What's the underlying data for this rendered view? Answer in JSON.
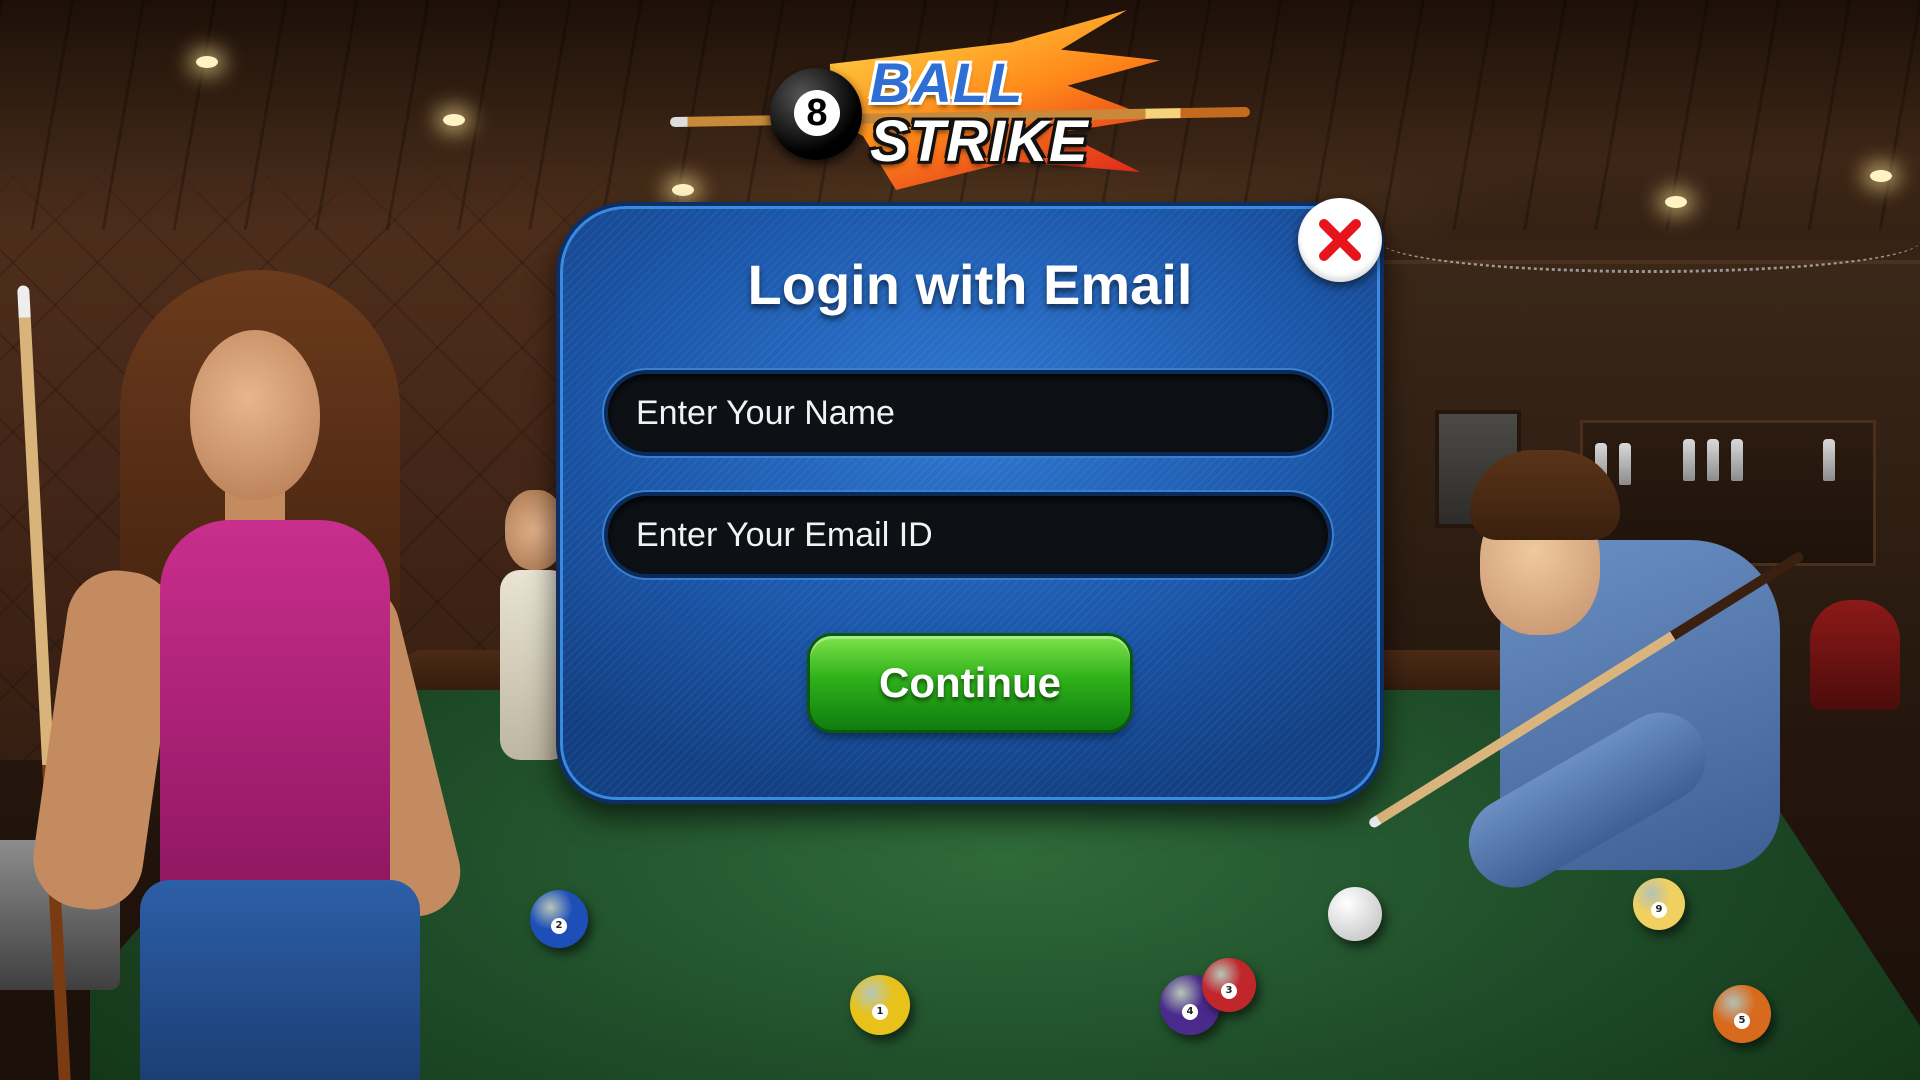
{
  "logo": {
    "number": "8",
    "word_top": "BALL",
    "word_bottom": "STRIKE"
  },
  "dialog": {
    "title": "Login with Email",
    "name_field": {
      "placeholder": "Enter Your Name",
      "value": ""
    },
    "email_field": {
      "placeholder": "Enter Your Email ID",
      "value": ""
    },
    "continue_label": "Continue",
    "close_icon": "close-x-icon"
  },
  "table_balls": [
    {
      "number": "2",
      "color": "#1e4fb8"
    },
    {
      "number": "1",
      "color": "#e8c21a"
    },
    {
      "number": "4",
      "color": "#4a2a8c"
    },
    {
      "number": "3",
      "color": "#c0262a"
    },
    {
      "number": "9",
      "color": "#f0d060"
    },
    {
      "number": "5",
      "color": "#d86a1e"
    }
  ],
  "colors": {
    "dialog_blue": "#1a55a8",
    "continue_green": "#2fb11a",
    "close_red": "#e8141c"
  }
}
